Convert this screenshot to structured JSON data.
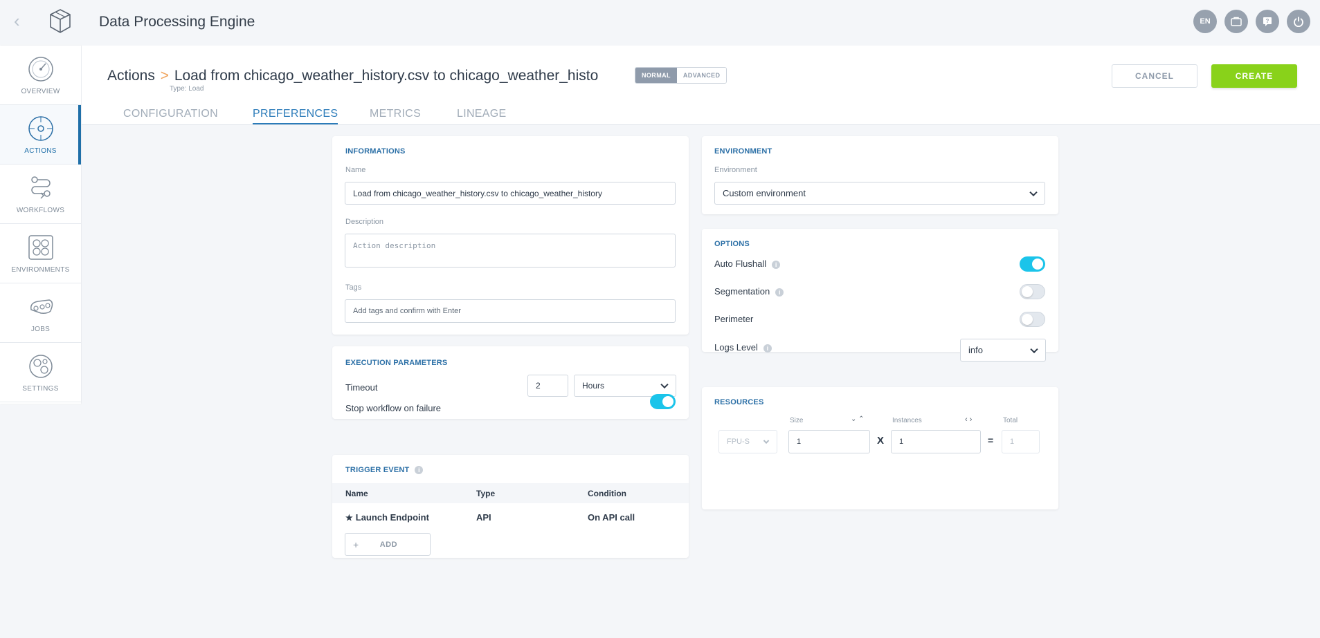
{
  "app": {
    "title": "Data Processing Engine"
  },
  "topbar": {
    "language": "EN"
  },
  "sidebar": {
    "items": [
      {
        "label": "OVERVIEW"
      },
      {
        "label": "ACTIONS"
      },
      {
        "label": "WORKFLOWS"
      },
      {
        "label": "ENVIRONMENTS"
      },
      {
        "label": "JOBS"
      },
      {
        "label": "SETTINGS"
      }
    ]
  },
  "header": {
    "breadcrumb_root": "Actions",
    "breadcrumb_sep": ">",
    "action_title": "Load from chicago_weather_history.csv to chicago_weather_history",
    "type_label": "Type:",
    "type_value": "Load",
    "mode_normal": "NORMAL",
    "mode_advanced": "ADVANCED",
    "cancel_label": "CANCEL",
    "create_label": "CREATE",
    "tabs": [
      {
        "label": "CONFIGURATION"
      },
      {
        "label": "PREFERENCES"
      },
      {
        "label": "METRICS"
      },
      {
        "label": "LINEAGE"
      }
    ]
  },
  "informations": {
    "title": "INFORMATIONS",
    "name_label": "Name",
    "name_value": "Load from chicago_weather_history.csv to chicago_weather_history",
    "description_label": "Description",
    "description_placeholder": "Action description",
    "tags_label": "Tags",
    "tags_placeholder": "Add tags and confirm with Enter"
  },
  "execution": {
    "title": "EXECUTION PARAMETERS",
    "timeout_label": "Timeout",
    "timeout_value": "2",
    "timeout_unit": "Hours",
    "stop_label": "Stop workflow on failure"
  },
  "trigger": {
    "title": "TRIGGER EVENT",
    "columns": [
      "Name",
      "Type",
      "Condition"
    ],
    "rows": [
      {
        "name": "Launch Endpoint",
        "type": "API",
        "condition": "On API call"
      }
    ],
    "add_label": "ADD"
  },
  "environment": {
    "title": "ENVIRONMENT",
    "label": "Environment",
    "value": "Custom environment"
  },
  "options": {
    "title": "OPTIONS",
    "auto_flushall": "Auto Flushall",
    "segmentation": "Segmentation",
    "perimeter": "Perimeter",
    "logs_level": "Logs Level",
    "logs_level_value": "info"
  },
  "resources": {
    "title": "RESOURCES",
    "size_label": "Size",
    "instances_label": "Instances",
    "total_label": "Total",
    "unit": "FPU-S",
    "size_value": "1",
    "multiply": "X",
    "instances_value": "1",
    "equals": "=",
    "total_value": "1"
  }
}
